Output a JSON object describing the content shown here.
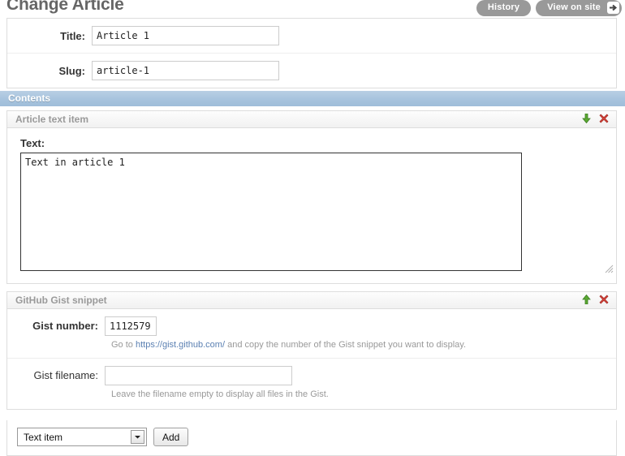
{
  "header": {
    "title": "Change Article",
    "tools": {
      "history_label": "History",
      "view_on_site_label": "View on site",
      "arrow_icon": "arrow-right-icon"
    }
  },
  "form": {
    "rows": [
      {
        "label": "Title:",
        "value": "Article 1"
      },
      {
        "label": "Slug:",
        "value": "article-1"
      }
    ]
  },
  "contents": {
    "bar_label": "Contents",
    "inlines": [
      {
        "title": "Article text item",
        "move_icon": "arrow-down-green-icon",
        "delete_icon": "delete-red-x-icon",
        "field_label": "Text:",
        "field_value": "Text in article 1",
        "resize_icon": "resize-grip-icon"
      },
      {
        "title": "GitHub Gist snippet",
        "move_icon": "arrow-up-green-icon",
        "delete_icon": "delete-red-x-icon",
        "gist_number_label": "Gist number:",
        "gist_number_value": "1112579",
        "gist_number_help_prefix": "Go to ",
        "gist_number_help_link": "https://gist.github.com/",
        "gist_number_help_suffix": " and copy the number of the Gist snippet you want to display.",
        "gist_filename_label": "Gist filename:",
        "gist_filename_value": "",
        "gist_filename_help": "Leave the filename empty to display all files in the Gist."
      }
    ]
  },
  "add_row": {
    "select_value": "Text item",
    "select_options": [
      "Text item",
      "GitHub Gist snippet"
    ],
    "dropdown_icon": "chevron-down-icon",
    "add_label": "Add"
  },
  "colors": {
    "contents_bar": "#a8c4de",
    "tool_button": "#999999",
    "link": "#5b80b2",
    "green_arrow": "#4ca832",
    "red_delete": "#d14836"
  }
}
